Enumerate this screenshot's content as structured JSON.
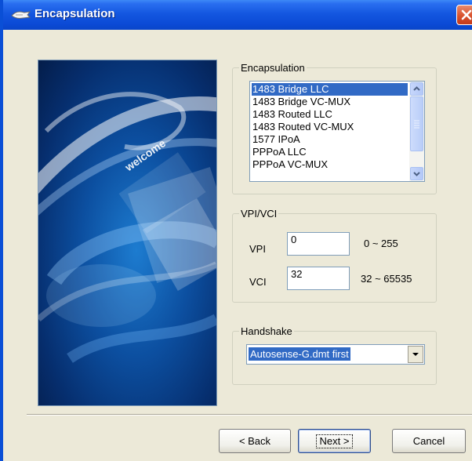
{
  "window": {
    "title": "Encapsulation",
    "close_glyph": "×"
  },
  "banner": {
    "welcome_text": "welcome"
  },
  "encapsulation": {
    "legend": "Encapsulation",
    "items": [
      "1483 Bridge LLC",
      "1483 Bridge VC-MUX",
      "1483 Routed LLC",
      "1483 Routed VC-MUX",
      "1577 IPoA",
      "PPPoA LLC",
      "PPPoA VC-MUX"
    ],
    "selected_item": "1483 Bridge LLC"
  },
  "vpivci": {
    "legend": "VPI/VCI",
    "vpi_label": "VPI",
    "vpi_value": "0",
    "vpi_range": "0 ~ 255",
    "vci_label": "VCI",
    "vci_value": "32",
    "vci_range": "32 ~ 65535"
  },
  "handshake": {
    "legend": "Handshake",
    "selected_value": "Autosense-G.dmt first"
  },
  "buttons": {
    "back": "< Back",
    "next": "Next >",
    "cancel": "Cancel"
  },
  "colors": {
    "titlebar": "#0a4fd6",
    "selection": "#316ac5",
    "close_button": "#d9532e",
    "face": "#ece9d8"
  },
  "icons": {
    "title": "hand-wave-icon",
    "close": "close-icon",
    "scroll_up": "chevron-up-icon",
    "scroll_down": "chevron-down-icon",
    "dropdown": "chevron-down-icon"
  }
}
